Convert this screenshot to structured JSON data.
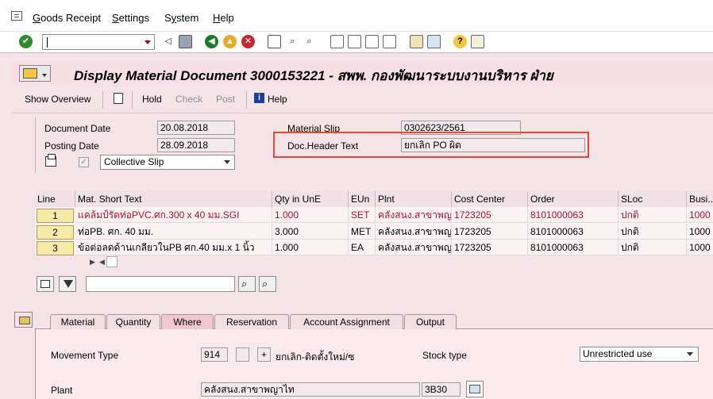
{
  "menu": [
    "Goods Receipt",
    "Settings",
    "System",
    "Help"
  ],
  "menu_hotkeys": [
    "G",
    "S",
    "y",
    "H"
  ],
  "title": "Display Material Document 3000153221 - สพพ. กองพัฒนาระบบงานบริหาร ฝ่าย",
  "toolbar": {
    "show_overview": "Show Overview",
    "hold": "Hold",
    "check": "Check",
    "post": "Post",
    "help": "Help"
  },
  "header": {
    "document_date_label": "Document Date",
    "document_date": "20.08.2018",
    "posting_date_label": "Posting Date",
    "posting_date": "28.09.2018",
    "material_slip_label": "Material Slip",
    "material_slip": "0302623/2561",
    "doc_header_text_label": "Doc.Header Text",
    "doc_header_text": "ยกเลิก PO ผิด",
    "slip_type": "Collective Slip"
  },
  "table": {
    "columns": [
      "Line",
      "Mat. Short Text",
      "Qty in UnE",
      "EUn",
      "Plnt",
      "Cost Center",
      "Order",
      "SLoc",
      "Busi..."
    ],
    "rows": [
      {
        "line": "1",
        "text": "แคล้มป์รัดท่อPVC.ศก.300 x 40 มม.SGI",
        "qty": "1.000",
        "eun": "SET",
        "plnt": "คลังสนง.สาขาพญ...",
        "cost_center": "1723205",
        "order": "8101000063",
        "sloc": "ปกติ",
        "busi": "1000",
        "highlight": true
      },
      {
        "line": "2",
        "text": "ท่อPB. ศก. 40 มม.",
        "qty": "3.000",
        "eun": "MET",
        "plnt": "คลังสนง.สาขาพญ...",
        "cost_center": "1723205",
        "order": "8101000063",
        "sloc": "ปกติ",
        "busi": "1000",
        "highlight": false
      },
      {
        "line": "3",
        "text": "ข้อต่อลดด้านเกลียวในPB ศก.40 มม.x 1 นิ้ว",
        "qty": "1.000",
        "eun": "EA",
        "plnt": "คลังสนง.สาขาพญ...",
        "cost_center": "1723205",
        "order": "8101000063",
        "sloc": "ปกติ",
        "busi": "1000",
        "highlight": false
      }
    ]
  },
  "tabs": [
    "Material",
    "Quantity",
    "Where",
    "Reservation",
    "Account Assignment",
    "Output"
  ],
  "active_tab": "Where",
  "detail": {
    "movement_type_label": "Movement Type",
    "movement_type": "914",
    "movement_plus": "+",
    "movement_desc": "ยกเลิก-ติดตั้งใหม่/ซ",
    "stock_type_label": "Stock type",
    "stock_type": "Unrestricted use",
    "plant_label": "Plant",
    "plant_name": "คลังสนง.สาขาพญาไท",
    "plant_code": "3B30"
  },
  "colors": {
    "background": "#f4e4e8",
    "highlight_border": "#e04a3a",
    "red_text": "#b0102a"
  }
}
